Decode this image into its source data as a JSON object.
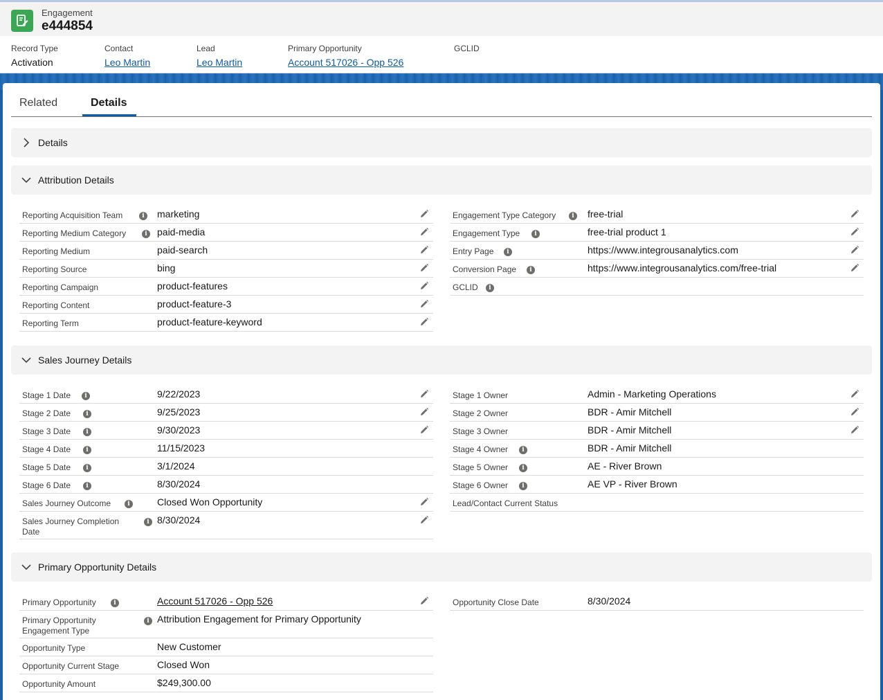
{
  "header": {
    "object_type": "Engagement",
    "record_name": "e444854",
    "fields": [
      {
        "label": "Record Type",
        "value": "Activation",
        "link": false
      },
      {
        "label": "Contact",
        "value": "Leo Martin",
        "link": true
      },
      {
        "label": "Lead",
        "value": "Leo Martin",
        "link": true
      },
      {
        "label": "Primary Opportunity",
        "value": "Account 517026 - Opp 526",
        "link": true
      },
      {
        "label": "GCLID",
        "value": "",
        "link": false
      }
    ]
  },
  "tabs": [
    {
      "label": "Related",
      "active": false
    },
    {
      "label": "Details",
      "active": true
    }
  ],
  "sections": {
    "details": {
      "title": "Details",
      "expanded": false
    },
    "attribution": {
      "title": "Attribution Details",
      "expanded": true,
      "left": [
        {
          "label": "Reporting Acquisition Team",
          "value": "marketing",
          "info": true,
          "editable": true
        },
        {
          "label": "Reporting Medium Category",
          "value": "paid-media",
          "info": true,
          "editable": true
        },
        {
          "label": "Reporting Medium",
          "value": "paid-search",
          "info": false,
          "editable": true
        },
        {
          "label": "Reporting Source",
          "value": "bing",
          "info": false,
          "editable": true
        },
        {
          "label": "Reporting Campaign",
          "value": "product-features",
          "info": false,
          "editable": true
        },
        {
          "label": "Reporting Content",
          "value": "product-feature-3",
          "info": false,
          "editable": true
        },
        {
          "label": "Reporting Term",
          "value": "product-feature-keyword",
          "info": false,
          "editable": true
        }
      ],
      "right": [
        {
          "label": "Engagement Type Category",
          "value": "free-trial",
          "info": true,
          "editable": true
        },
        {
          "label": "Engagement Type",
          "value": "free-trial product 1",
          "info": true,
          "editable": true
        },
        {
          "label": "Entry Page",
          "value": "https://www.integrousanalytics.com",
          "info": true,
          "editable": true
        },
        {
          "label": "Conversion Page",
          "value": "https://www.integrousanalytics.com/free-trial",
          "info": true,
          "editable": true
        },
        {
          "label": "GCLID",
          "value": "",
          "info": true,
          "editable": false
        }
      ]
    },
    "sales_journey": {
      "title": "Sales Journey Details",
      "expanded": true,
      "left": [
        {
          "label": "Stage 1 Date",
          "value": "9/22/2023",
          "info": true,
          "editable": true
        },
        {
          "label": "Stage 2 Date",
          "value": "9/25/2023",
          "info": true,
          "editable": true
        },
        {
          "label": "Stage 3 Date",
          "value": "9/30/2023",
          "info": true,
          "editable": true
        },
        {
          "label": "Stage 4 Date",
          "value": "11/15/2023",
          "info": true,
          "editable": false
        },
        {
          "label": "Stage 5 Date",
          "value": "3/1/2024",
          "info": true,
          "editable": false
        },
        {
          "label": "Stage 6 Date",
          "value": "8/30/2024",
          "info": true,
          "editable": false
        },
        {
          "label": "Sales Journey Outcome",
          "value": "Closed Won Opportunity",
          "info": true,
          "editable": true
        },
        {
          "label": "Sales Journey Completion Date",
          "value": "8/30/2024",
          "info": true,
          "editable": true
        }
      ],
      "right": [
        {
          "label": "Stage 1 Owner",
          "value": "Admin - Marketing Operations",
          "info": false,
          "editable": true
        },
        {
          "label": "Stage 2 Owner",
          "value": "BDR - Amir Mitchell",
          "info": false,
          "editable": true
        },
        {
          "label": "Stage 3 Owner",
          "value": "BDR - Amir Mitchell",
          "info": false,
          "editable": true
        },
        {
          "label": "Stage 4 Owner",
          "value": "BDR - Amir Mitchell",
          "info": true,
          "editable": false
        },
        {
          "label": "Stage 5 Owner",
          "value": "AE - River Brown",
          "info": true,
          "editable": false
        },
        {
          "label": "Stage 6 Owner",
          "value": "AE VP - River Brown",
          "info": true,
          "editable": false
        },
        {
          "label": "Lead/Contact Current Status",
          "value": "",
          "info": false,
          "editable": false
        }
      ]
    },
    "primary_opportunity": {
      "title": "Primary Opportunity Details",
      "expanded": true,
      "left": [
        {
          "label": "Primary Opportunity",
          "value": "Account 517026 - Opp 526",
          "info": true,
          "editable": true,
          "link": true
        },
        {
          "label": "Primary Opportunity Engagement Type",
          "value": "Attribution Engagement for Primary Opportunity",
          "info": true,
          "editable": false
        },
        {
          "label": "Opportunity Type",
          "value": "New Customer",
          "info": false,
          "editable": false
        },
        {
          "label": "Opportunity Current Stage",
          "value": "Closed Won",
          "info": false,
          "editable": false
        },
        {
          "label": "Opportunity Amount",
          "value": "$249,300.00",
          "info": false,
          "editable": false
        }
      ],
      "right": [
        {
          "label": "Opportunity Close Date",
          "value": "8/30/2024",
          "info": false,
          "editable": false
        }
      ]
    }
  },
  "icons": {
    "record": "engagement-record-icon",
    "edit": "pencil-icon",
    "info": "info-icon",
    "chevron_right": "chevron-right-icon",
    "chevron_down": "chevron-down-icon"
  },
  "colors": {
    "brand_blue": "#0b5cab",
    "record_icon": "#3ba755"
  }
}
